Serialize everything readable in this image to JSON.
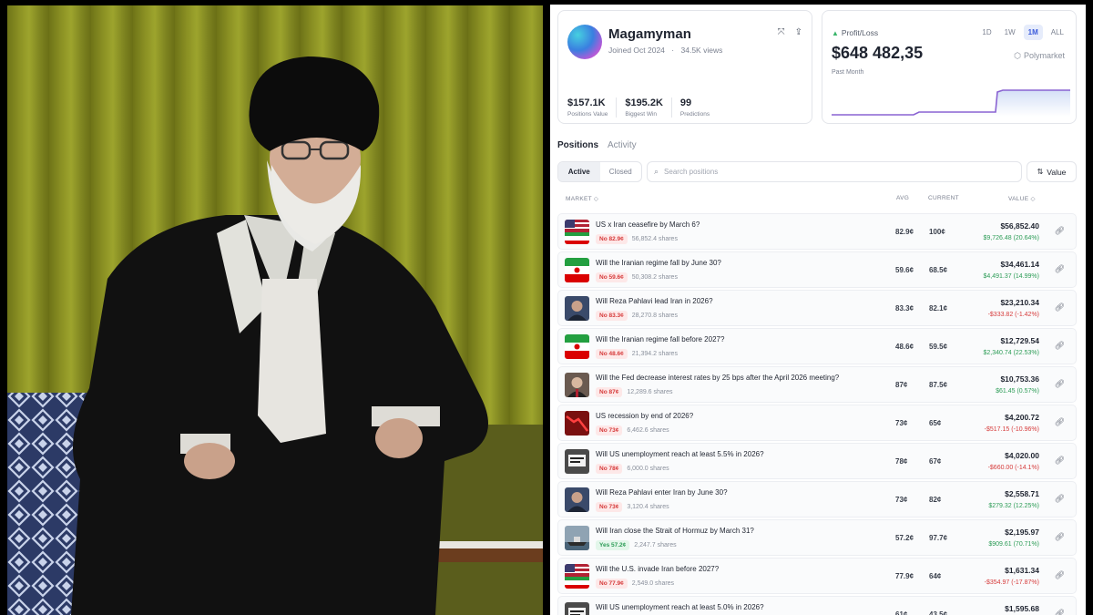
{
  "profile": {
    "name": "Magamyman",
    "joined": "Joined Oct 2024",
    "separator": "·",
    "views": "34.5K views",
    "expand_icon": "expand-icon",
    "share_icon": "share-icon",
    "stats": [
      {
        "value": "$157.1K",
        "label": "Positions Value"
      },
      {
        "value": "$195.2K",
        "label": "Biggest Win"
      },
      {
        "value": "99",
        "label": "Predictions"
      }
    ]
  },
  "pnl": {
    "label": "Profit/Loss",
    "value": "$648 482,35",
    "period": "Past Month",
    "tabs": [
      "1D",
      "1W",
      "1M",
      "ALL"
    ],
    "active_tab": "1M",
    "brand": "Polymarket",
    "line_color": "#8a63d2"
  },
  "tabs": {
    "positions": "Positions",
    "activity": "Activity"
  },
  "filters": {
    "active": "Active",
    "closed": "Closed",
    "search_placeholder": "Search positions",
    "sort_label": "Value"
  },
  "table": {
    "headers": {
      "market": "MARKET ◇",
      "avg": "AVG",
      "current": "CURRENT",
      "value": "VALUE ◇"
    },
    "rows": [
      {
        "title": "US x Iran ceasefire by March 6?",
        "side": "No",
        "price": "82.9¢",
        "badge": "No 82.9¢",
        "shares": "56,852.4 shares",
        "avg": "82.9¢",
        "current": "100¢",
        "value": "$56,852.40",
        "pnl": "$9,726.48 (20.64%)",
        "dir": "up",
        "thumb": "flags"
      },
      {
        "title": "Will the Iranian regime fall by June 30?",
        "side": "No",
        "price": "59.6¢",
        "badge": "No 59.6¢",
        "shares": "50,308.2 shares",
        "avg": "59.6¢",
        "current": "68.5¢",
        "value": "$34,461.14",
        "pnl": "$4,491.37 (14.99%)",
        "dir": "up",
        "thumb": "iran-flag"
      },
      {
        "title": "Will Reza Pahlavi lead Iran in 2026?",
        "side": "No",
        "price": "83.3¢",
        "badge": "No 83.3¢",
        "shares": "28,270.8 shares",
        "avg": "83.3¢",
        "current": "82.1¢",
        "value": "$23,210.34",
        "pnl": "-$333.82 (-1.42%)",
        "dir": "down",
        "thumb": "portrait"
      },
      {
        "title": "Will the Iranian regime fall before 2027?",
        "side": "No",
        "price": "48.6¢",
        "badge": "No 48.6¢",
        "shares": "21,394.2 shares",
        "avg": "48.6¢",
        "current": "59.5¢",
        "value": "$12,729.54",
        "pnl": "$2,340.74 (22.53%)",
        "dir": "up",
        "thumb": "iran-flag"
      },
      {
        "title": "Will the Fed decrease interest rates by 25 bps after the April 2026 meeting?",
        "side": "No",
        "price": "87¢",
        "badge": "No 87¢",
        "shares": "12,289.6 shares",
        "avg": "87¢",
        "current": "87.5¢",
        "value": "$10,753.36",
        "pnl": "$61.45 (0.57%)",
        "dir": "up",
        "thumb": "portrait2"
      },
      {
        "title": "US recession by end of 2026?",
        "side": "No",
        "price": "73¢",
        "badge": "No 73¢",
        "shares": "6,462.6 shares",
        "avg": "73¢",
        "current": "65¢",
        "value": "$4,200.72",
        "pnl": "-$517.15 (-10.96%)",
        "dir": "down",
        "thumb": "red-chart"
      },
      {
        "title": "Will US unemployment reach at least 5.5% in 2026?",
        "side": "No",
        "price": "78¢",
        "badge": "No 78¢",
        "shares": "6,000.0 shares",
        "avg": "78¢",
        "current": "67¢",
        "value": "$4,020.00",
        "pnl": "-$660.00 (-14.1%)",
        "dir": "down",
        "thumb": "sign"
      },
      {
        "title": "Will Reza Pahlavi enter Iran by June 30?",
        "side": "No",
        "price": "73¢",
        "badge": "No 73¢",
        "shares": "3,120.4 shares",
        "avg": "73¢",
        "current": "82¢",
        "value": "$2,558.71",
        "pnl": "$279.32 (12.25%)",
        "dir": "up",
        "thumb": "portrait"
      },
      {
        "title": "Will Iran close the Strait of Hormuz by March 31?",
        "side": "Yes",
        "price": "57.2¢",
        "badge": "Yes 57.2¢",
        "shares": "2,247.7 shares",
        "avg": "57.2¢",
        "current": "97.7¢",
        "value": "$2,195.97",
        "pnl": "$909.61 (70.71%)",
        "dir": "up",
        "thumb": "ship"
      },
      {
        "title": "Will the U.S. invade Iran before 2027?",
        "side": "No",
        "price": "77.9¢",
        "badge": "No 77.9¢",
        "shares": "2,549.0 shares",
        "avg": "77.9¢",
        "current": "64¢",
        "value": "$1,631.34",
        "pnl": "-$354.97 (-17.87%)",
        "dir": "down",
        "thumb": "flags"
      },
      {
        "title": "Will US unemployment reach at least 5.0% in 2026?",
        "side": "No",
        "price": "61¢",
        "badge": "No 61¢",
        "shares": "",
        "avg": "61¢",
        "current": "43.5¢",
        "value": "$1,595.68",
        "pnl": "",
        "dir": "down",
        "thumb": "sign"
      }
    ]
  }
}
